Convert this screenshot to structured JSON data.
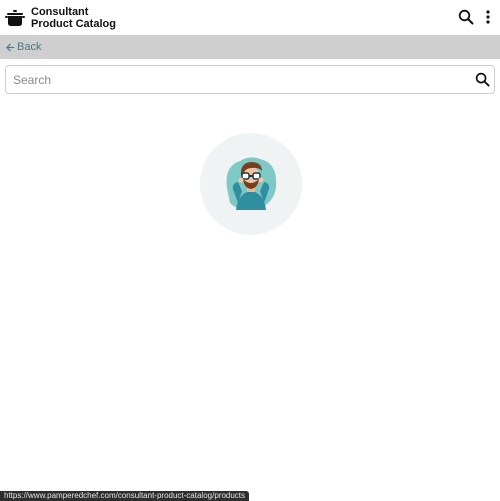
{
  "header": {
    "title_line1": "Consultant",
    "title_line2": "Product Catalog",
    "logo_icon": "cooking-pot-icon",
    "search_icon": "search-icon",
    "more_icon": "more-vertical-icon"
  },
  "nav": {
    "back_label": "Back",
    "back_icon": "arrow-left-icon"
  },
  "search": {
    "placeholder": "Search",
    "value": "",
    "icon": "search-icon"
  },
  "illustration": {
    "icon": "person-with-binoculars-icon"
  },
  "status_url": "https://www.pamperedchef.com/consultant-product-catalog/products",
  "colors": {
    "backbar": "#cfcfcf",
    "accent": "#4a7a83",
    "illustration_bg": "#eff3f4",
    "illustration_teal": "#7ec8c6"
  }
}
